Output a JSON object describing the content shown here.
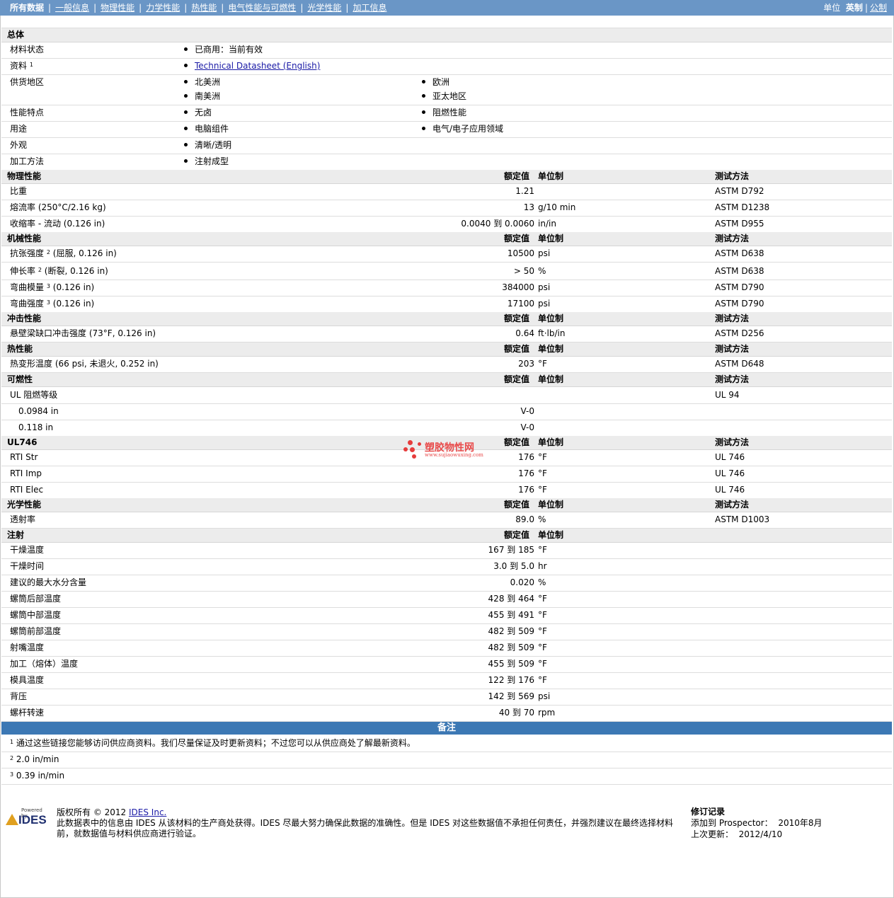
{
  "nav": {
    "items": [
      "所有数据",
      "一般信息",
      "物理性能",
      "力学性能",
      "热性能",
      "电气性能与可燃性",
      "光学性能",
      "加工信息"
    ],
    "units_label": "单位",
    "unit_english": "英制",
    "unit_metric": "公制"
  },
  "general": {
    "title": "总体",
    "status_label": "材料状态",
    "status_value": "已商用：当前有效",
    "source_label": "资料",
    "source_sup": "1",
    "source_link": "Technical Datasheet (English)",
    "regions_label": "供货地区",
    "regions": [
      "北美洲",
      "欧洲",
      "南美洲",
      "亚太地区"
    ],
    "features_label": "性能特点",
    "features": [
      "无卤",
      "阻燃性能"
    ],
    "uses_label": "用途",
    "uses": [
      "电脑组件",
      "电气/电子应用领域"
    ],
    "appearance_label": "外观",
    "appearance": "清晰/透明",
    "processing_label": "加工方法",
    "processing": "注射成型"
  },
  "col_headers": {
    "value": "额定值",
    "unit": "单位制",
    "test": "测试方法"
  },
  "physical": {
    "title": "物理性能",
    "rows": [
      {
        "label": "比重",
        "sup": "",
        "cond": "",
        "value": "1.21",
        "unit": "",
        "test": "ASTM D792"
      },
      {
        "label": "熔流率",
        "sup": "",
        "cond": "(250°C/2.16 kg)",
        "value": "13",
        "unit": "g/10 min",
        "test": "ASTM D1238"
      },
      {
        "label": "收缩率 - 流动",
        "sup": "",
        "cond": "(0.126 in)",
        "value": "0.0040 到 0.0060",
        "unit": "in/in",
        "test": "ASTM D955"
      }
    ]
  },
  "mechanical": {
    "title": "机械性能",
    "rows": [
      {
        "label": "抗张强度",
        "sup": "2",
        "cond": "(屈服, 0.126 in)",
        "value": "10500",
        "unit": "psi",
        "test": "ASTM D638"
      },
      {
        "label": "伸长率",
        "sup": "2",
        "cond": "(断裂, 0.126 in)",
        "value": "> 50",
        "unit": "%",
        "test": "ASTM D638"
      },
      {
        "label": "弯曲模量",
        "sup": "3",
        "cond": "(0.126 in)",
        "value": "384000",
        "unit": "psi",
        "test": "ASTM D790"
      },
      {
        "label": "弯曲强度",
        "sup": "3",
        "cond": "(0.126 in)",
        "value": "17100",
        "unit": "psi",
        "test": "ASTM D790"
      }
    ]
  },
  "impact": {
    "title": "冲击性能",
    "rows": [
      {
        "label": "悬壁梁缺口冲击强度",
        "sup": "",
        "cond": "(73°F, 0.126 in)",
        "value": "0.64",
        "unit": "ft·lb/in",
        "test": "ASTM D256"
      }
    ]
  },
  "thermal": {
    "title": "热性能",
    "rows": [
      {
        "label": "热变形温度",
        "sup": "",
        "cond": "(66 psi, 未退火, 0.252 in)",
        "value": "203",
        "unit": "°F",
        "test": "ASTM D648"
      }
    ]
  },
  "flammability": {
    "title": "可燃性",
    "main_label": "UL 阻燃等级",
    "main_test": "UL 94",
    "sub": [
      {
        "label": "0.0984 in",
        "value": "V-0"
      },
      {
        "label": "0.118 in",
        "value": "V-0"
      }
    ]
  },
  "ul746": {
    "title": "UL746",
    "rows": [
      {
        "label": "RTI Str",
        "sup": "",
        "cond": "",
        "value": "176",
        "unit": "°F",
        "test": "UL 746"
      },
      {
        "label": "RTI Imp",
        "sup": "",
        "cond": "",
        "value": "176",
        "unit": "°F",
        "test": "UL 746"
      },
      {
        "label": "RTI Elec",
        "sup": "",
        "cond": "",
        "value": "176",
        "unit": "°F",
        "test": "UL 746"
      }
    ]
  },
  "optical": {
    "title": "光学性能",
    "rows": [
      {
        "label": "透射率",
        "sup": "",
        "cond": "",
        "value": "89.0",
        "unit": "%",
        "test": "ASTM D1003"
      }
    ]
  },
  "injection": {
    "title": "注射",
    "rows": [
      {
        "label": "干燥温度",
        "value": "167 到 185",
        "unit": "°F"
      },
      {
        "label": "干燥时间",
        "value": "3.0 到 5.0",
        "unit": "hr"
      },
      {
        "label": "建议的最大水分含量",
        "value": "0.020",
        "unit": "%"
      },
      {
        "label": "螺筒后部温度",
        "value": "428 到 464",
        "unit": "°F"
      },
      {
        "label": "螺筒中部温度",
        "value": "455 到 491",
        "unit": "°F"
      },
      {
        "label": "螺筒前部温度",
        "value": "482 到 509",
        "unit": "°F"
      },
      {
        "label": "射嘴温度",
        "value": "482 到 509",
        "unit": "°F"
      },
      {
        "label": "加工（熔体）温度",
        "value": "455 到 509",
        "unit": "°F"
      },
      {
        "label": "模具温度",
        "value": "122 到 176",
        "unit": "°F"
      },
      {
        "label": "背压",
        "value": "142 到 569",
        "unit": "psi"
      },
      {
        "label": "螺杆转速",
        "value": "40 到 70",
        "unit": "rpm"
      }
    ]
  },
  "notes": {
    "title": "备注",
    "items": [
      {
        "sup": "1",
        "text": "通过这些链接您能够访问供应商资料。我们尽量保证及时更新资料；不过您可以从供应商处了解最新资料。"
      },
      {
        "sup": "2",
        "text": "2.0 in/min"
      },
      {
        "sup": "3",
        "text": "0.39 in/min"
      }
    ]
  },
  "footer": {
    "logo_powered": "Powered by",
    "logo_text": "IDES",
    "copyright_prefix": "版权所有 © 2012",
    "copyright_link": "IDES Inc.",
    "disclaimer": "此数据表中的信息由 IDES 从该材料的生产商处获得。IDES 尽最大努力确保此数据的准确性。但是 IDES 对这些数据值不承担任何责任，并强烈建议在最终选择材料前，就数据值与材料供应商进行验证。",
    "rev_title": "修订记录",
    "added_label": "添加到 Prospector：",
    "added_value": "2010年8月",
    "updated_label": "上次更新：",
    "updated_value": "2012/4/10"
  },
  "watermark": {
    "title": "塑胶物性网",
    "url": "www.sujiaowuxing.com"
  }
}
